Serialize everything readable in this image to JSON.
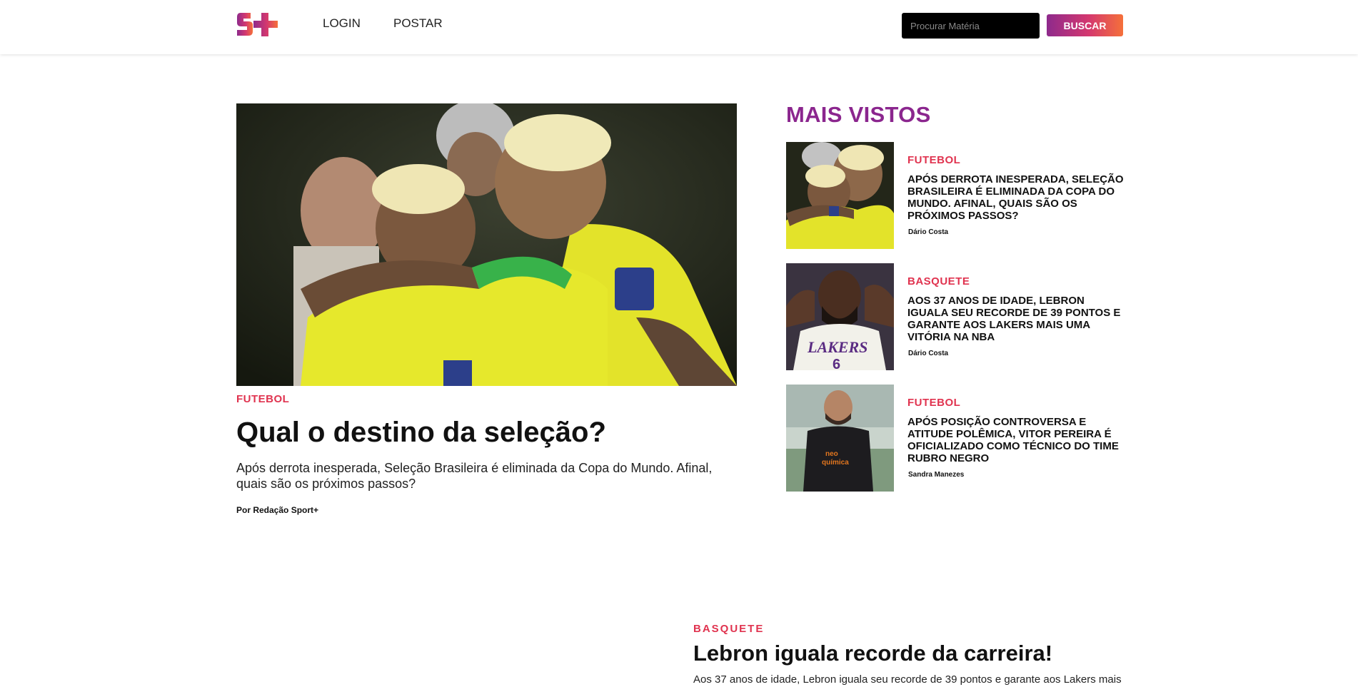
{
  "brand": {
    "logo_text": "S+",
    "colors": {
      "purple": "#8b268e",
      "magenta": "#d4386f",
      "orange": "#f5703a",
      "category_red": "#e0334f"
    }
  },
  "header": {
    "nav": [
      {
        "label": "LOGIN"
      },
      {
        "label": "POSTAR"
      }
    ],
    "search": {
      "placeholder": "Procurar Matéria",
      "value": "",
      "button_label": "BUSCAR"
    }
  },
  "featured": {
    "image_icon": "brazil-team-players-embracing-photo",
    "category": "FUTEBOL",
    "title": "Qual o destino da seleção?",
    "summary": "Após derrota inesperada, Seleção Brasileira é eliminada da Copa do Mundo. Afinal, quais são os próximos passos?",
    "author": "Por Redação Sport+"
  },
  "sidebar": {
    "title": "MAIS VISTOS",
    "items": [
      {
        "image_icon": "brazil-players-photo",
        "category": "FUTEBOL",
        "title": "Após derrota inesperada, Seleção Brasileira é eliminada da Copa do Mundo. Afinal, quais são os próximos passos?",
        "author": "Dário Costa"
      },
      {
        "image_icon": "lebron-lakers-photo",
        "category": "BASQUETE",
        "title": "Aos 37 anos de idade, Lebron iguala seu recorde de 39 pontos e garante aos Lakers mais uma vitória na NBA",
        "author": "Dário Costa"
      },
      {
        "image_icon": "vitor-pereira-coach-photo",
        "category": "FUTEBOL",
        "title": "Após posição controversa e atitude polêmica, Vitor Pereira é oficializado como técnico do time Rubro Negro",
        "author": "Sandra Manezes"
      }
    ]
  },
  "second_article": {
    "category": "BASQUETE",
    "title": "Lebron iguala recorde da carreira!",
    "summary": "Aos 37 anos de idade, Lebron iguala seu recorde de 39 pontos e garante aos Lakers mais"
  }
}
